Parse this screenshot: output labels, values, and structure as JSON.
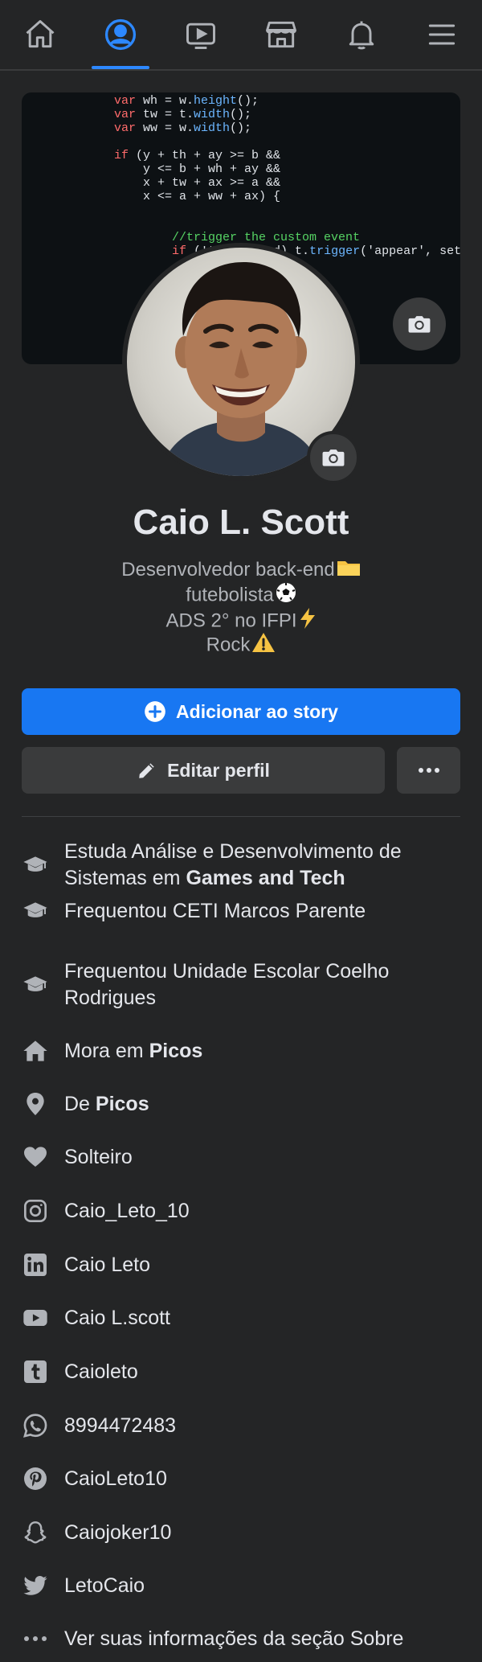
{
  "nav": {
    "items": [
      {
        "icon": "home-icon",
        "active": false
      },
      {
        "icon": "profile-icon",
        "active": true
      },
      {
        "icon": "watch-icon",
        "active": false
      },
      {
        "icon": "marketplace-icon",
        "active": false
      },
      {
        "icon": "bell-icon",
        "active": false
      },
      {
        "icon": "menu-icon",
        "active": false
      }
    ],
    "accent": "#2d88ff"
  },
  "cover": {
    "code_lines": [
      {
        "kw": "var ",
        "text": "wh = w.",
        "fn": "height",
        "rest": "();"
      },
      {
        "kw": "var ",
        "text": "tw = t.",
        "fn": "width",
        "rest": "();"
      },
      {
        "kw": "var ",
        "text": "ww = w.",
        "fn": "width",
        "rest": "();"
      },
      {
        "kw": "",
        "text": "",
        "fn": "",
        "rest": ""
      },
      {
        "kw": "if ",
        "text": "(y + th + ay >= b &&",
        "fn": "",
        "rest": ""
      },
      {
        "kw": "",
        "text": "    y <= b + wh + ay &&",
        "fn": "",
        "rest": ""
      },
      {
        "kw": "",
        "text": "    x + tw + ax >= a &&",
        "fn": "",
        "rest": ""
      },
      {
        "kw": "",
        "text": "    x <= a + ww + ax) {",
        "fn": "",
        "rest": ""
      },
      {
        "kw": "",
        "text": "",
        "fn": "",
        "rest": ""
      },
      {
        "kw": "",
        "text": "",
        "fn": "",
        "rest": ""
      },
      {
        "kw": "",
        "text": "        //trigger the custom event",
        "fn": "",
        "rest": "",
        "comment": true
      },
      {
        "kw": "        if ",
        "text": "(!t.appeared) t.",
        "fn": "trigger",
        "rest": "('appear', settings.d"
      }
    ]
  },
  "profile": {
    "name": "Caio L. Scott",
    "bio": [
      {
        "text": "Desenvolvedor back-end",
        "emoji": "folder"
      },
      {
        "text": "futebolista",
        "emoji": "soccer"
      },
      {
        "text": "ADS 2° no IFPI",
        "emoji": "bolt"
      },
      {
        "text": "Rock",
        "emoji": "warning"
      }
    ]
  },
  "actions": {
    "story_label": "Adicionar ao story",
    "edit_label": "Editar perfil"
  },
  "info": [
    {
      "icon": "education-icon",
      "prefix": "Estuda Análise e Desenvolvimento de Sistemas em ",
      "bold": "Games and Tech"
    },
    {
      "icon": "education-icon",
      "prefix": "Frequentou CETI Marcos Parente",
      "bold": ""
    },
    {
      "icon": "education-icon",
      "prefix": "Frequentou Unidade Escolar Coelho Rodrigues",
      "bold": ""
    },
    {
      "icon": "home-icon",
      "prefix": "Mora em ",
      "bold": "Picos"
    },
    {
      "icon": "location-pin-icon",
      "prefix": "De ",
      "bold": "Picos"
    },
    {
      "icon": "heart-icon",
      "prefix": "Solteiro",
      "bold": ""
    },
    {
      "icon": "instagram-icon",
      "prefix": "Caio_Leto_10",
      "bold": ""
    },
    {
      "icon": "linkedin-icon",
      "prefix": "Caio Leto",
      "bold": ""
    },
    {
      "icon": "youtube-icon",
      "prefix": "Caio L.scott",
      "bold": ""
    },
    {
      "icon": "tumblr-icon",
      "prefix": "Caioleto",
      "bold": ""
    },
    {
      "icon": "whatsapp-icon",
      "prefix": "8994472483",
      "bold": ""
    },
    {
      "icon": "pinterest-icon",
      "prefix": "CaioLeto10",
      "bold": ""
    },
    {
      "icon": "snapchat-icon",
      "prefix": "Caiojoker10",
      "bold": ""
    },
    {
      "icon": "twitter-icon",
      "prefix": "LetoCaio",
      "bold": ""
    },
    {
      "icon": "more-dots-icon",
      "prefix": "Ver suas informações da seção Sobre",
      "bold": ""
    }
  ],
  "colors": {
    "background": "#242526",
    "button_primary": "#1877f2",
    "button_secondary": "#3a3b3c",
    "text_primary": "#e4e6eb",
    "text_secondary": "#b0b3b8"
  }
}
